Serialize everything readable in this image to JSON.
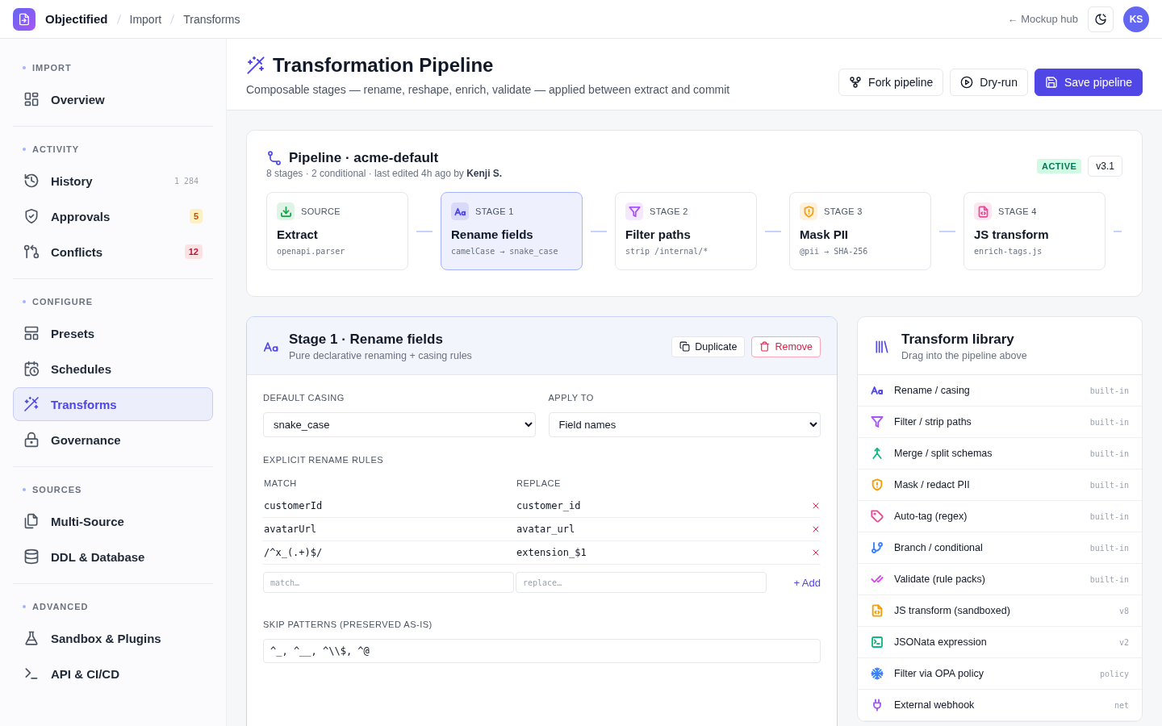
{
  "topbar": {
    "brand": "Objectified",
    "breadcrumbs": [
      "Import",
      "Transforms"
    ],
    "back_link": "← Mockup hub",
    "avatar": "KS"
  },
  "sidebar": {
    "sections": [
      {
        "title": "IMPORT",
        "items": [
          {
            "label": "Overview",
            "selected": false
          }
        ]
      },
      {
        "title": "ACTIVITY",
        "items": [
          {
            "label": "History",
            "selected": false,
            "badge": {
              "text": "1 284",
              "kind": "count"
            }
          },
          {
            "label": "Approvals",
            "selected": false,
            "badge": {
              "text": "5",
              "kind": "warning"
            }
          },
          {
            "label": "Conflicts",
            "selected": false,
            "badge": {
              "text": "12",
              "kind": "danger"
            }
          }
        ]
      },
      {
        "title": "CONFIGURE",
        "items": [
          {
            "label": "Presets",
            "selected": false
          },
          {
            "label": "Schedules",
            "selected": false
          },
          {
            "label": "Transforms",
            "selected": true
          },
          {
            "label": "Governance",
            "selected": false
          }
        ]
      },
      {
        "title": "SOURCES",
        "items": [
          {
            "label": "Multi-Source",
            "selected": false
          },
          {
            "label": "DDL & Database",
            "selected": false
          }
        ]
      },
      {
        "title": "ADVANCED",
        "items": [
          {
            "label": "Sandbox & Plugins",
            "selected": false
          },
          {
            "label": "API & CI/CD",
            "selected": false
          }
        ]
      }
    ]
  },
  "header": {
    "title": "Transformation Pipeline",
    "subtitle": "Composable stages — rename, reshape, enrich, validate — applied between extract and commit",
    "buttons": [
      {
        "label": "Fork pipeline",
        "kind": "secondary"
      },
      {
        "label": "Dry-run",
        "kind": "secondary"
      },
      {
        "label": "Save pipeline",
        "kind": "primary"
      }
    ]
  },
  "pipeline": {
    "title": "Pipeline · acme-default",
    "meta": "8 stages · 2 conditional · last edited 4h ago by **Kenji S.**",
    "status": "ACTIVE",
    "version": "v3.1",
    "stages": [
      {
        "tag": "SOURCE",
        "name": "Extract",
        "detail": "openapi.parser",
        "color": "#16a34a",
        "selected": false
      },
      {
        "tag": "STAGE 1",
        "name": "Rename fields",
        "detail": "camelCase → snake_case",
        "color": "#4f46e5",
        "selected": true
      },
      {
        "tag": "STAGE 2",
        "name": "Filter paths",
        "detail": "strip /internal/*",
        "color": "#a855f7",
        "selected": false
      },
      {
        "tag": "STAGE 3",
        "name": "Mask PII",
        "detail": "@pii → SHA-256",
        "color": "#f59e0b",
        "selected": false
      },
      {
        "tag": "STAGE 4",
        "name": "JS transform",
        "detail": "enrich-tags.js",
        "color": "#ec4899",
        "selected": false
      }
    ]
  },
  "editor": {
    "title": "Stage 1 · Rename fields",
    "subtitle": "Pure declarative renaming + casing rules",
    "buttons": [
      {
        "label": "Duplicate",
        "kind": "secondary"
      },
      {
        "label": "Remove",
        "kind": "danger"
      }
    ],
    "selects": [
      {
        "label": "DEFAULT CASING",
        "value": "snake_case"
      },
      {
        "label": "APPLY TO",
        "value": "Field names"
      }
    ],
    "rules_label": "EXPLICIT RENAME RULES",
    "columns": [
      "MATCH",
      "REPLACE"
    ],
    "rules": [
      {
        "match": "customerId",
        "replace": "customer_id"
      },
      {
        "match": "avatarUrl",
        "replace": "avatar_url"
      },
      {
        "match": "/^x_(.+)$/",
        "replace": "extension_$1"
      }
    ],
    "new_rule": {
      "match_placeholder": "match…",
      "replace_placeholder": "replace…",
      "add_label": "+ Add"
    },
    "skip": {
      "label": "SKIP PATTERNS (PRESERVED AS-IS)",
      "value": "^_, ^__, ^\\\\$, ^@"
    }
  },
  "library": {
    "title": "Transform library",
    "subtitle": "Drag into the pipeline above",
    "items": [
      {
        "label": "Rename / casing",
        "tag": "built-in",
        "color": "#4f46e5"
      },
      {
        "label": "Filter / strip paths",
        "tag": "built-in",
        "color": "#a855f7"
      },
      {
        "label": "Merge / split schemas",
        "tag": "built-in",
        "color": "#10b981"
      },
      {
        "label": "Mask / redact PII",
        "tag": "built-in",
        "color": "#f59e0b"
      },
      {
        "label": "Auto-tag (regex)",
        "tag": "built-in",
        "color": "#ec4899"
      },
      {
        "label": "Branch / conditional",
        "tag": "built-in",
        "color": "#3b82f6"
      },
      {
        "label": "Validate (rule packs)",
        "tag": "built-in",
        "color": "#d946ef"
      },
      {
        "label": "JS transform (sandboxed)",
        "tag": "v8",
        "color": "#f59e0b"
      },
      {
        "label": "JSONata expression",
        "tag": "v2",
        "color": "#10b981"
      },
      {
        "label": "Filter via OPA policy",
        "tag": "policy",
        "color": "#3b82f6"
      },
      {
        "label": "External webhook",
        "tag": "net",
        "color": "#a855f7"
      }
    ]
  }
}
